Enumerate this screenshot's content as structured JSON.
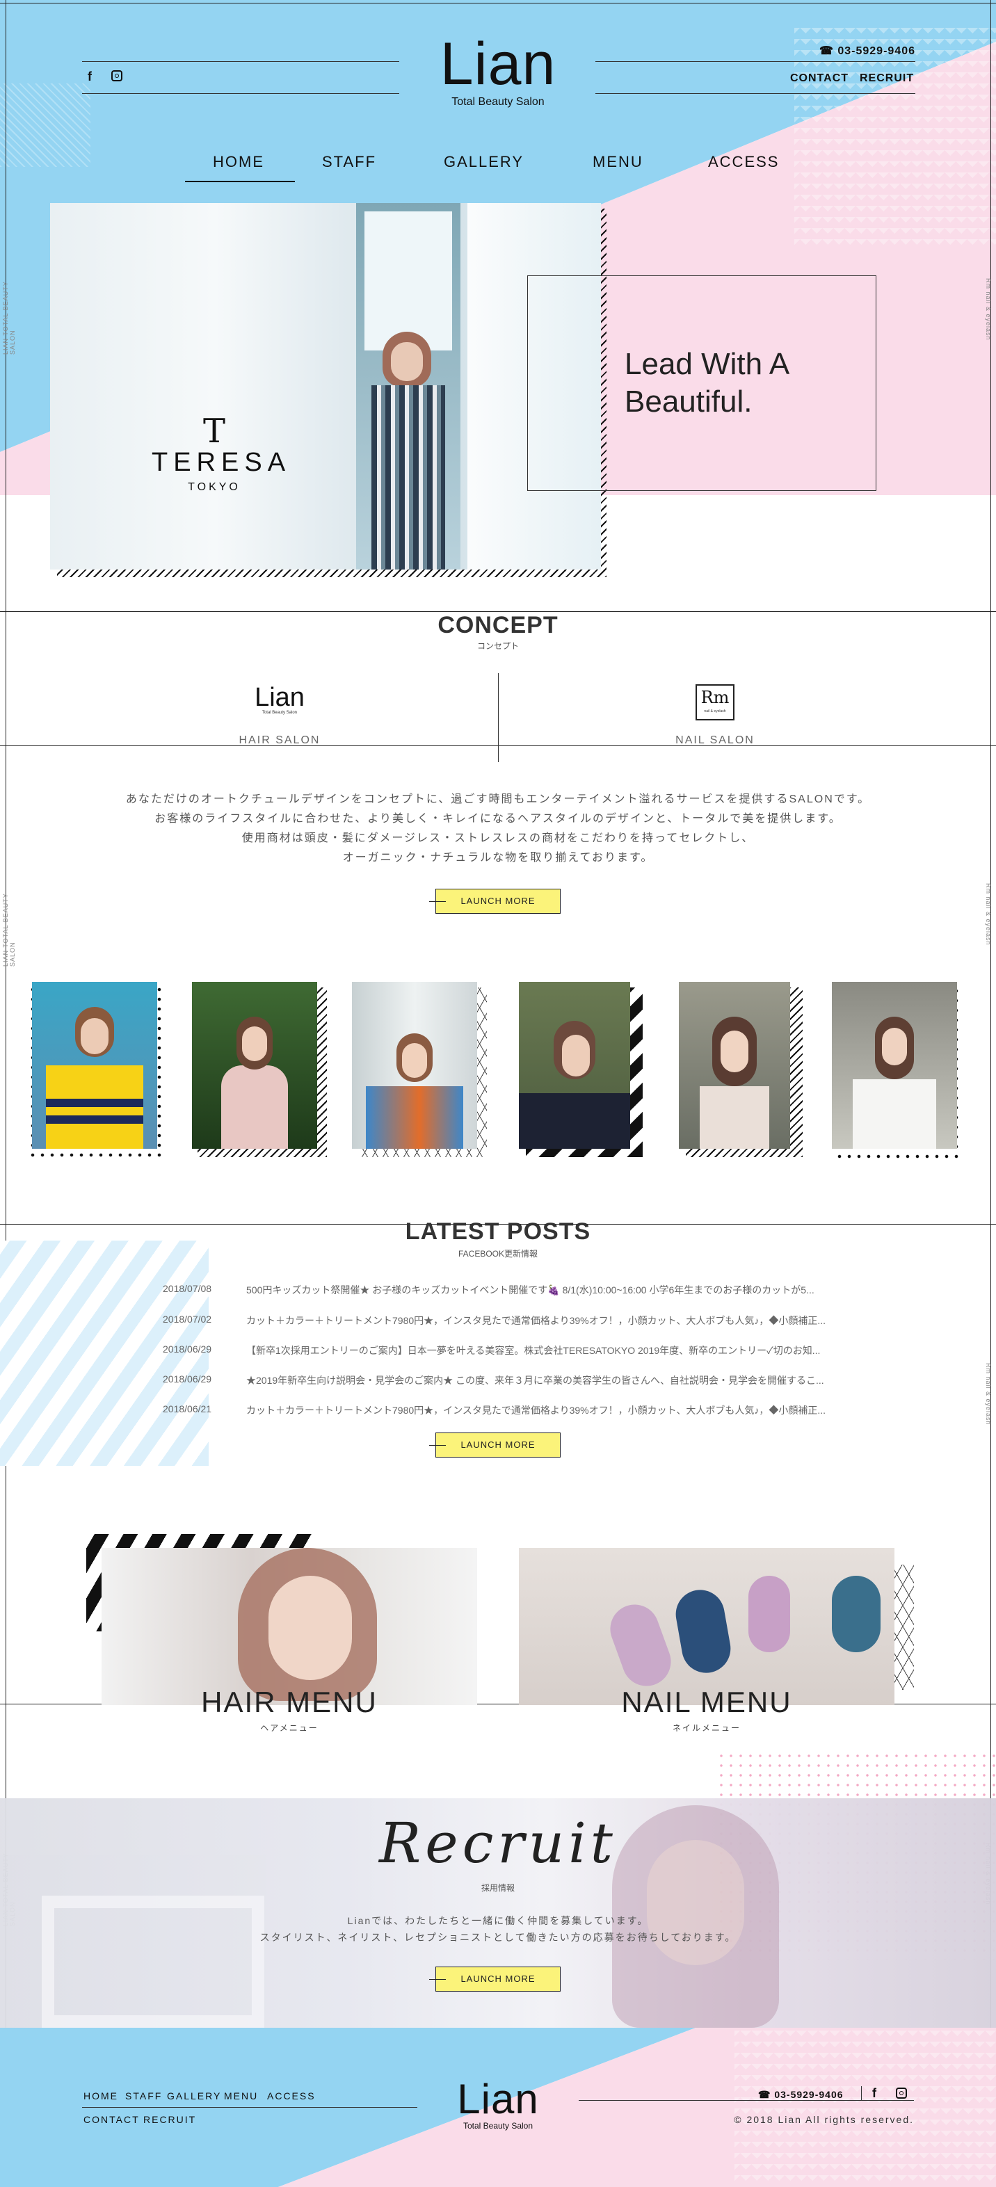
{
  "header": {
    "logo": "Lian",
    "logo_sub": "Total Beauty Salon",
    "phone": "☎ 03-5929-9406",
    "contact_label": "CONTACT",
    "recruit_label": "RECRUIT",
    "facebook_icon": "f",
    "instagram_icon": "◻"
  },
  "nav": {
    "items": [
      {
        "label": "HOME"
      },
      {
        "label": "STAFF"
      },
      {
        "label": "GALLERY"
      },
      {
        "label": "MENU"
      },
      {
        "label": "ACCESS"
      }
    ],
    "active": "HOME"
  },
  "hero": {
    "brand_mark": "T",
    "brand_name": "TERESA",
    "brand_city": "TOKYO",
    "tagline_line1": "Lead With A",
    "tagline_line2": "Beautiful."
  },
  "side_labels": {
    "left": "LIAN TOTAL BEAUTY SALON",
    "right": "Rm nail & eyelash"
  },
  "concept": {
    "title": "CONCEPT",
    "subtitle": "コンセプト",
    "hair_logo": "Lian",
    "hair_logo_sub": "Total Beauty Salon",
    "hair_label": "HAIR SALON",
    "nail_logo": "Rm",
    "nail_logo_sub": "nail & eyelash",
    "nail_label": "NAIL SALON",
    "text": [
      "あなただけのオートクチュールデザインをコンセプトに、過ごす時間もエンターテイメント溢れるサービスを提供するSALONです。",
      "お客様のライフスタイルに合わせた、より美しく・キレイになるヘアスタイルのデザインと、トータルで美を提供します。",
      "使用商材は頭皮・髪にダメージレス・ストレスレスの商材をこだわりを持ってセレクトし、",
      "オーガニック・ナチュラルな物を取り揃えております。"
    ],
    "button": "LAUNCH MORE"
  },
  "posts": {
    "title": "LATEST POSTS",
    "subtitle": "FACEBOOK更新情報",
    "items": [
      {
        "date": "2018/07/08",
        "text": "500円キッズカット祭開催★ お子様のキッズカットイベント開催です🍇 8/1(水)10:00~16:00 小学6年生までのお子様のカットが5..."
      },
      {
        "date": "2018/07/02",
        "text": "カット＋カラー＋トリートメント7980円★，インスタ見たで通常価格より39%オフ！，小顔カット、大人ボブも人気♪，◆小顔補正..."
      },
      {
        "date": "2018/06/29",
        "text": "【新卒1次採用エントリーのご案内】日本一夢を叶える美容室。株式会社TERESATOKYO 2019年度、新卒のエントリー✓切のお知..."
      },
      {
        "date": "2018/06/29",
        "text": "★2019年新卒生向け説明会・見学会のご案内★ この度、来年３月に卒業の美容学生の皆さんへ、自社説明会・見学会を開催するこ..."
      },
      {
        "date": "2018/06/21",
        "text": "カット＋カラー＋トリートメント7980円★，インスタ見たで通常価格より39%オフ！，小顔カット、大人ボブも人気♪，◆小顔補正..."
      }
    ],
    "button": "LAUNCH MORE"
  },
  "menus": {
    "hair_title": "HAIR MENU",
    "hair_sub": "ヘアメニュー",
    "nail_title": "NAIL MENU",
    "nail_sub": "ネイルメニュー"
  },
  "recruit": {
    "script": "Recruit",
    "subtitle": "採用情報",
    "line1": "Lianでは、わたしたちと一緒に働く仲間を募集しています。",
    "line2": "スタイリスト、ネイリスト、レセプショニストとして働きたい方の応募をお待ちしております。",
    "button": "LAUNCH MORE"
  },
  "footer": {
    "links_row1": [
      "HOME",
      "STAFF",
      "GALLERY",
      "MENU",
      "ACCESS"
    ],
    "links_row2": [
      "CONTACT",
      "RECRUIT"
    ],
    "logo": "Lian",
    "logo_sub": "Total Beauty Salon",
    "phone": "☎ 03-5929-9406",
    "copyright": "© 2018 Lian All rights reserved."
  },
  "colors": {
    "blue": "#94d4f2",
    "pink": "#fadce9",
    "yellow": "#fbf37a",
    "ink": "#222222"
  }
}
